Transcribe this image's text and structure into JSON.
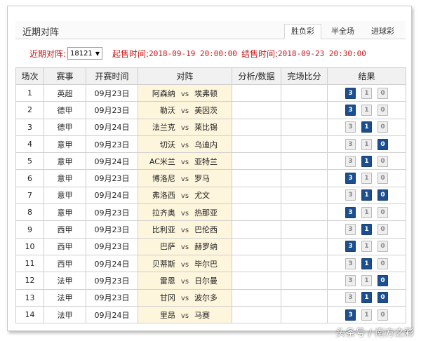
{
  "panel": {
    "title": "近期对阵",
    "tabs": [
      {
        "label": "胜负彩",
        "active": true
      },
      {
        "label": "半全场",
        "active": false
      },
      {
        "label": "进球彩",
        "active": false
      }
    ]
  },
  "info": {
    "issue_label": "近期对阵:",
    "issue_value": "18121",
    "start_label": "起售时间:",
    "start_time": "2018-09-19 20:00:00",
    "end_label": "结售时间:",
    "end_time": "2018-09-23 20:30:00"
  },
  "table": {
    "headers": [
      "场次",
      "赛事",
      "开赛时间",
      "对阵",
      "分析/数据",
      "完场比分",
      "结果"
    ],
    "vs_text": "vs",
    "result_labels": [
      "3",
      "1",
      "0"
    ],
    "rows": [
      {
        "no": "1",
        "league": "英超",
        "date": "09月23日",
        "home": "阿森纳",
        "away": "埃弗顿",
        "selected": [
          "3"
        ]
      },
      {
        "no": "2",
        "league": "德甲",
        "date": "09月23日",
        "home": "勒沃",
        "away": "美因茨",
        "selected": [
          "3"
        ]
      },
      {
        "no": "3",
        "league": "德甲",
        "date": "09月24日",
        "home": "法兰克",
        "away": "莱比锡",
        "selected": [
          "1"
        ]
      },
      {
        "no": "4",
        "league": "意甲",
        "date": "09月23日",
        "home": "切沃",
        "away": "乌迪内",
        "selected": [
          "0"
        ]
      },
      {
        "no": "5",
        "league": "意甲",
        "date": "09月24日",
        "home": "AC米兰",
        "away": "亚特兰",
        "selected": [
          "1"
        ]
      },
      {
        "no": "6",
        "league": "意甲",
        "date": "09月23日",
        "home": "博洛尼",
        "away": "罗马",
        "selected": [
          "3"
        ]
      },
      {
        "no": "7",
        "league": "意甲",
        "date": "09月24日",
        "home": "弗洛西",
        "away": "尤文",
        "selected": [
          "1",
          "0"
        ]
      },
      {
        "no": "8",
        "league": "意甲",
        "date": "09月23日",
        "home": "拉齐奥",
        "away": "热那亚",
        "selected": [
          "3"
        ]
      },
      {
        "no": "9",
        "league": "西甲",
        "date": "09月23日",
        "home": "比利亚",
        "away": "巴伦西",
        "selected": [
          "1"
        ]
      },
      {
        "no": "10",
        "league": "西甲",
        "date": "09月23日",
        "home": "巴萨",
        "away": "赫罗纳",
        "selected": [
          "3"
        ]
      },
      {
        "no": "11",
        "league": "西甲",
        "date": "09月24日",
        "home": "贝蒂斯",
        "away": "毕尔巴",
        "selected": [
          "1"
        ]
      },
      {
        "no": "12",
        "league": "法甲",
        "date": "09月23日",
        "home": "雷恩",
        "away": "日尔曼",
        "selected": [
          "0"
        ]
      },
      {
        "no": "13",
        "league": "法甲",
        "date": "09月23日",
        "home": "甘冈",
        "away": "波尔多",
        "selected": [
          "1",
          "0"
        ]
      },
      {
        "no": "14",
        "league": "法甲",
        "date": "09月24日",
        "home": "里昂",
        "away": "马赛",
        "selected": [
          "3"
        ]
      }
    ]
  },
  "watermark": "头条号 / 南方之彩",
  "colors": {
    "selected_button": "#1d4f8f",
    "title_red": "#c81818",
    "match_bg": "#fdf5dc"
  }
}
